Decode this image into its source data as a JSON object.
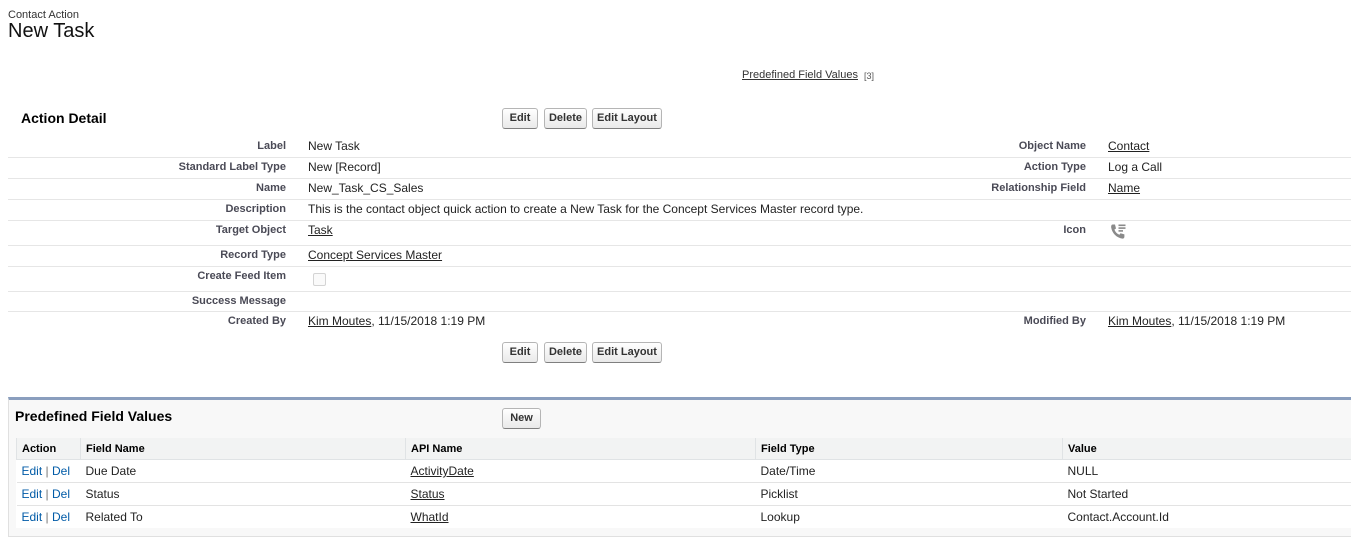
{
  "header": {
    "subtitle": "Contact Action",
    "title": "New Task",
    "predefined_link": "Predefined Field Values",
    "predefined_count": "[3]"
  },
  "detail": {
    "section_title": "Action Detail",
    "buttons": {
      "edit": "Edit",
      "delete": "Delete",
      "edit_layout": "Edit Layout"
    },
    "label": {
      "label": "Label",
      "value": "New Task"
    },
    "object_name": {
      "label": "Object Name",
      "value": "Contact"
    },
    "standard_label_type": {
      "label": "Standard Label Type",
      "value": "New [Record]"
    },
    "action_type": {
      "label": "Action Type",
      "value": "Log a Call"
    },
    "name": {
      "label": "Name",
      "value": "New_Task_CS_Sales"
    },
    "relationship_field": {
      "label": "Relationship Field",
      "value": "Name"
    },
    "description": {
      "label": "Description",
      "value": "This is the contact object quick action to create a New Task for the Concept Services Master record type."
    },
    "target_object": {
      "label": "Target Object",
      "value": "Task"
    },
    "icon": {
      "label": "Icon",
      "icon_name": "phone-log-call-icon"
    },
    "record_type": {
      "label": "Record Type",
      "value": "Concept Services Master"
    },
    "create_feed_item": {
      "label": "Create Feed Item",
      "checked": false
    },
    "success_message": {
      "label": "Success Message",
      "value": ""
    },
    "created_by": {
      "label": "Created By",
      "user": "Kim Moutes",
      "date": ", 11/15/2018 1:19 PM"
    },
    "modified_by": {
      "label": "Modified By",
      "user": "Kim Moutes",
      "date": ", 11/15/2018 1:19 PM"
    }
  },
  "related_list": {
    "title": "Predefined Field Values",
    "new_button": "New",
    "columns": [
      "Action",
      "Field Name",
      "API Name",
      "Field Type",
      "Value"
    ],
    "action_edit": "Edit",
    "action_sep": "|",
    "action_del": "Del",
    "rows": [
      {
        "field_name": "Due Date",
        "api_name": "ActivityDate",
        "field_type": "Date/Time",
        "value": "NULL"
      },
      {
        "field_name": "Status",
        "api_name": "Status",
        "field_type": "Picklist",
        "value": "Not Started"
      },
      {
        "field_name": "Related To",
        "api_name": "WhatId",
        "field_type": "Lookup",
        "value": "Contact.Account.Id"
      }
    ]
  },
  "colors": {
    "link_blue": "#015ba7",
    "section_border": "#8a9ebe"
  }
}
